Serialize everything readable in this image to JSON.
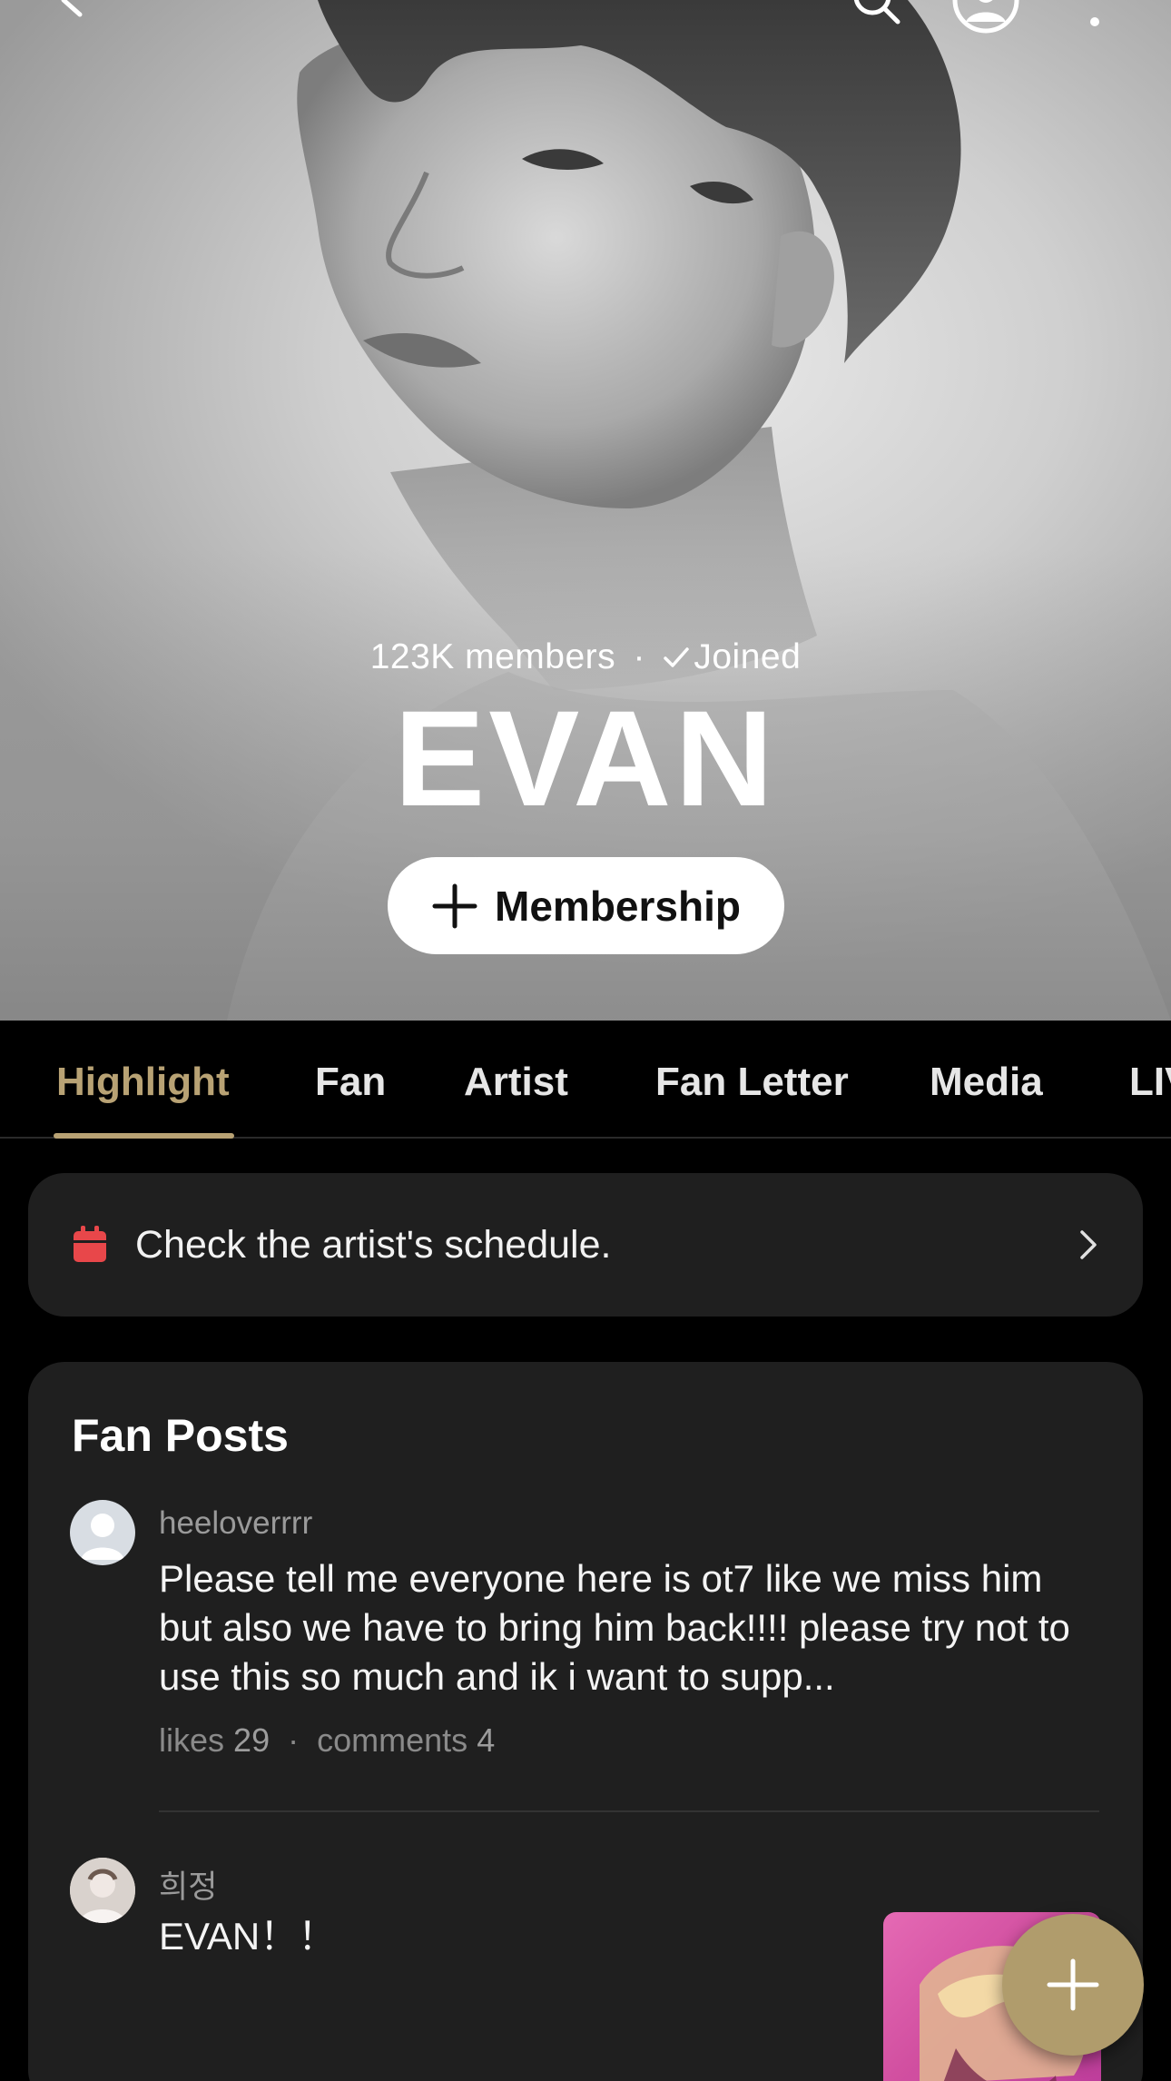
{
  "hero": {
    "members_count": "123K members",
    "separator": "·",
    "joined_label": "Joined",
    "artist_name": "EVAN",
    "membership_label": "Membership"
  },
  "top_bar": {
    "icons": [
      "back-icon",
      "search-icon",
      "profile-icon",
      "more-icon"
    ]
  },
  "tabs": [
    {
      "label": "Highlight",
      "active": true
    },
    {
      "label": "Fan",
      "active": false
    },
    {
      "label": "Artist",
      "active": false
    },
    {
      "label": "Fan Letter",
      "active": false
    },
    {
      "label": "Media",
      "active": false
    },
    {
      "label": "LIVE",
      "active": false
    }
  ],
  "schedule": {
    "label": "Check the artist's schedule."
  },
  "fan_posts": {
    "title": "Fan Posts",
    "posts": [
      {
        "username": "heeloverrrr",
        "body": "Please tell me everyone here is ot7 like we miss him but also we have to bring him back!!!! please try not to use this so much and ik i want to supp...",
        "likes_label": "likes",
        "likes": "29",
        "comments_label": "comments",
        "comments": "4"
      },
      {
        "username": "희정",
        "body": "EVAN！！"
      }
    ]
  },
  "colors": {
    "accent": "#b8a274",
    "fab": "#b09c6c",
    "card_bg": "#1f1f1f",
    "calendar_red": "#e8474a"
  }
}
